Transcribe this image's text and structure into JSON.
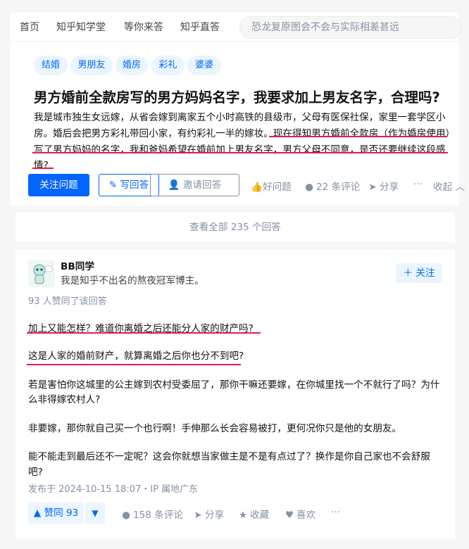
{
  "nav": {
    "items": [
      "首页",
      "知乎知学堂",
      "等你来答",
      "知乎直答"
    ],
    "search_placeholder": "恐龙复原图会不会与实际相差甚远"
  },
  "question": {
    "tags": [
      "结婚",
      "男朋友",
      "婚房",
      "彩礼",
      "婆婆"
    ],
    "title": "男方婚前全款房写的男方妈妈名字，我要求加上男友名字，合理吗?",
    "detail_lines": [
      "我是城市独生女远嫁，从省会嫁到离家五个小时高铁的县级市，父母有医保社保，家里一套学区小",
      "房。婚后会把男方彩礼带回小家，有约彩礼一半的嫁妆。现在得知男方婚前全款房（作为婚房使用）",
      "写了男方妈妈的名字，我和爸妈希望在婚前加上男友名字，男方父母不同意，是否还要继续这段感",
      "情?"
    ],
    "follow_label": "关注问题",
    "answer_label": "写回答",
    "invite_label": "邀请回答",
    "good_question": "好问题",
    "comments": "22 条评论",
    "share": "分享",
    "more": "···",
    "collapse": "收起"
  },
  "view_all": "查看全部 235 个回答",
  "answer": {
    "author": "BB同学",
    "bio": "我是知乎不出名的熬夜冠军博主。",
    "follow_label": "关注",
    "upvote_meta": "93 人赞同了该回答",
    "paragraphs": [
      "加上又能怎样？难道你离婚之后还能分人家的财产吗?",
      "这是人家的婚前财产，就算离婚之后你也分不到吧?",
      "若是害怕你这城里的公主嫁到农村受委屈了，那你干嘛还要嫁，在你城里找一个不就行了吗？为什",
      "么非得嫁农村人?",
      "非要嫁，那你就自己买一个也行啊！手伸那么长会容易被打，更何况你只是他的女朋友。",
      "能不能走到最后还不一定呢？这会你就想当家做主是不是有点过了？换作是你自己家也不会舒服",
      "吧?"
    ],
    "published": "发布于 2024-10-15 18:07・IP 属地广东",
    "vote_label": "赞同 93",
    "comments": "158 条评论",
    "share": "分享",
    "collect": "收藏",
    "like": "喜欢",
    "more": "···"
  },
  "colors": {
    "brand": "#0066ff",
    "underline": "#e8174f",
    "muted": "#8590a6"
  }
}
